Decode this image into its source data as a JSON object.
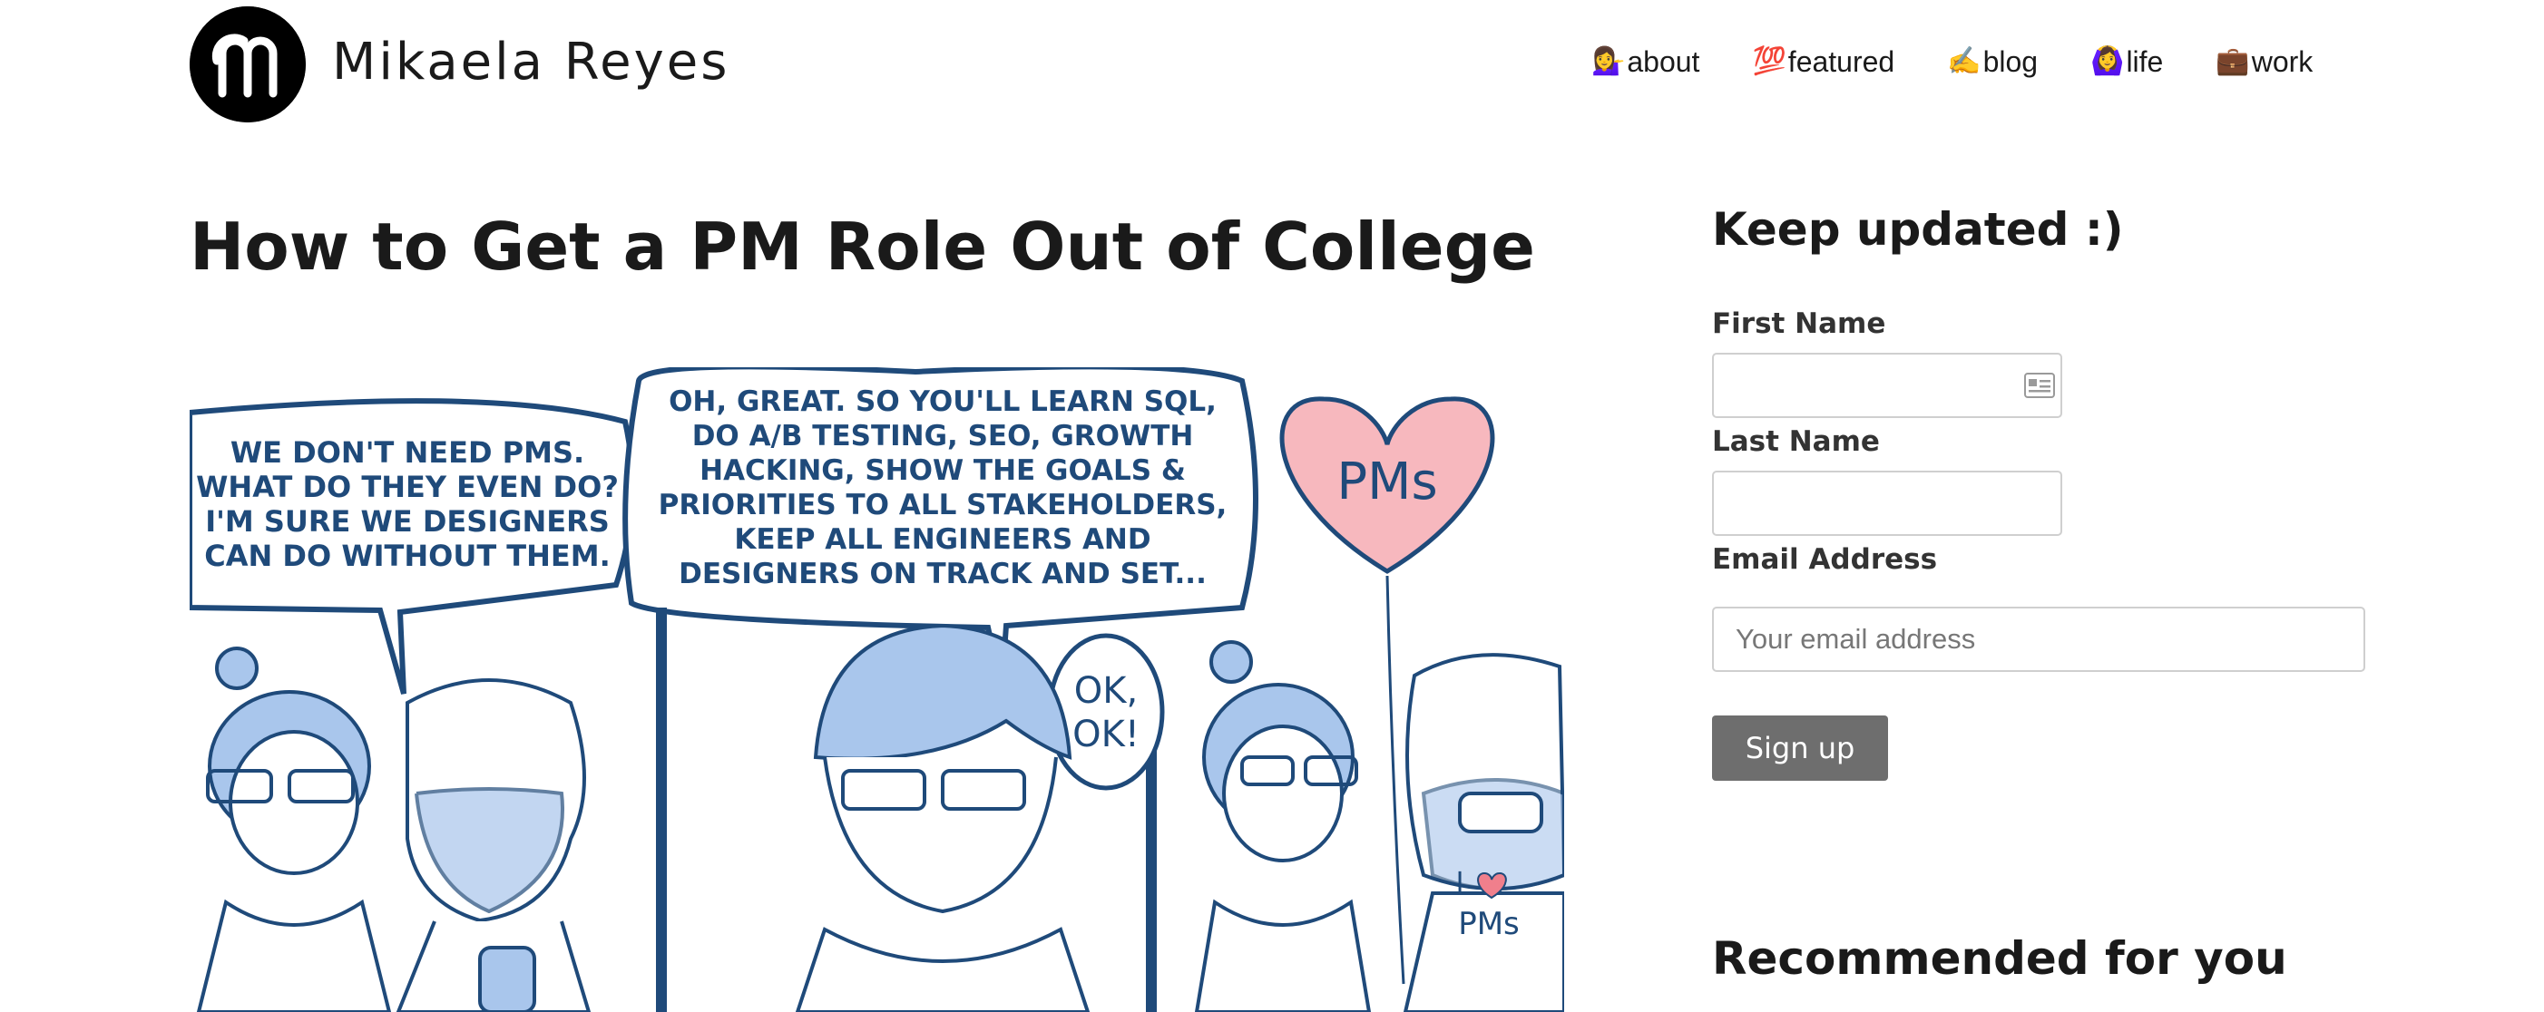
{
  "header": {
    "site_name": "Mikaela Reyes",
    "logo_icon": "mr-monogram-logo",
    "nav": [
      {
        "emoji": "💁‍♀️",
        "label": "about"
      },
      {
        "emoji": "💯",
        "label": "featured"
      },
      {
        "emoji": "✍️",
        "label": "blog"
      },
      {
        "emoji": "🙆‍♀️",
        "label": "life"
      },
      {
        "emoji": "💼",
        "label": "work"
      }
    ]
  },
  "article": {
    "title": "How to Get a PM Role Out of College",
    "comic": {
      "bubble_left": [
        "WE DON'T NEED PMS.",
        "WHAT DO THEY EVEN DO?",
        "I'M SURE WE DESIGNERS",
        "CAN DO WITHOUT THEM."
      ],
      "bubble_center": [
        "OH, GREAT. SO YOU'LL LEARN SQL,",
        "DO A/B TESTING, SEO, GROWTH",
        "HACKING, SHOW THE GOALS &",
        "PRIORITIES TO ALL STAKEHOLDERS,",
        "KEEP ALL ENGINEERS AND",
        "DESIGNERS ON TRACK AND SET..."
      ],
      "bubble_ok": [
        "OK,",
        "OK!"
      ],
      "balloon_text": "PMs",
      "shirt_text": [
        "I",
        "PMs"
      ]
    }
  },
  "sidebar": {
    "title": "Keep updated :)",
    "first_name_label": "First Name",
    "last_name_label": "Last Name",
    "email_label": "Email Address",
    "email_placeholder": "Your email address",
    "signup_label": "Sign up",
    "recommended_title": "Recommended for you"
  },
  "colors": {
    "comic_line": "#1f4a7a",
    "comic_fill": "#a9c6ec",
    "balloon_fill": "#f7b8be",
    "button_bg": "#6e6e6e"
  }
}
